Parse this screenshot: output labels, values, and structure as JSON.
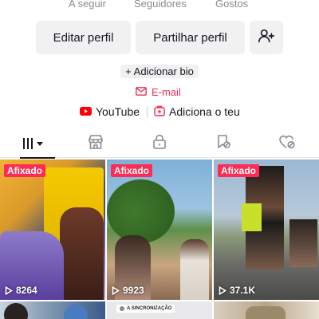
{
  "stats": {
    "following_label": "A seguir",
    "followers_label": "Seguidores",
    "likes_label": "Gostos"
  },
  "actions": {
    "edit_profile": "Editar perfil",
    "share_profile": "Partilhar perfil",
    "add_friend_icon": "add-user-icon"
  },
  "bio": {
    "add_bio": "+ Adicionar bio",
    "email": "E-mail"
  },
  "links": {
    "youtube": "YouTube",
    "add_yours": "Adiciona o teu"
  },
  "tabs": [
    {
      "icon": "grid-icon",
      "active": true
    },
    {
      "icon": "shop-icon",
      "active": false
    },
    {
      "icon": "lock-icon",
      "active": false
    },
    {
      "icon": "bookmark-icon",
      "active": false
    },
    {
      "icon": "heart-icon",
      "active": false
    }
  ],
  "videos": [
    {
      "badge": "Afixado",
      "views": "8264"
    },
    {
      "badge": "Afixado",
      "views": "9923"
    },
    {
      "badge": "Afixado",
      "views": "37.1K"
    },
    {
      "badge": "",
      "views": ""
    },
    {
      "badge": "",
      "views": "",
      "caption": "A SINCRONIZAÇÃO"
    },
    {
      "badge": "",
      "views": ""
    }
  ],
  "colors": {
    "accent": "#fe2c55",
    "email": "#e8315a",
    "youtube": "#ff0000",
    "text": "#161823",
    "muted": "#8a8b91",
    "button_bg": "#f1f1f2"
  }
}
